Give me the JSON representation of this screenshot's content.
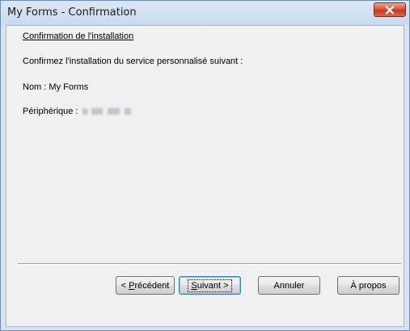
{
  "window": {
    "title": "My Forms - Confirmation"
  },
  "content": {
    "section_title": "Confirmation de l'installation",
    "instruction": "Confirmez l'installation du service personnalisé suivant :",
    "name_label": "Nom : ",
    "name_value": "My Forms",
    "device_label": "Périphérique : "
  },
  "buttons": {
    "previous": {
      "prefix": "< ",
      "mnemonic": "P",
      "rest": "récédent"
    },
    "next": {
      "mnemonic": "S",
      "rest": "uivant >"
    },
    "cancel": "Annuler",
    "about": "À propos"
  },
  "colors": {
    "title_bar": "#c9dbef",
    "close_button": "#c53720",
    "dialog_background": "#f0f0f0"
  },
  "icons": {
    "close": "close-x-icon"
  }
}
